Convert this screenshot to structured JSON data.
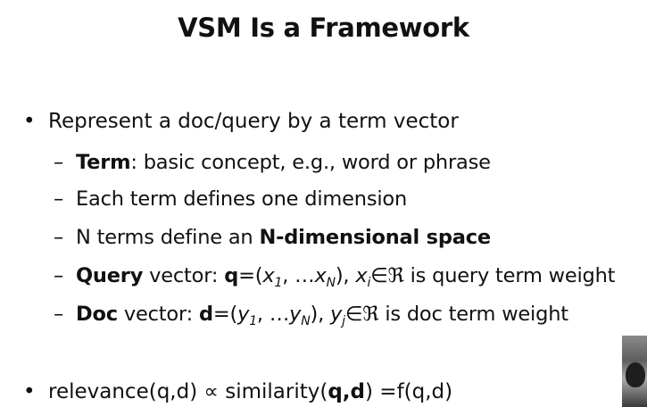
{
  "slide": {
    "title": "VSM Is a Framework",
    "bullet_symbol": "•",
    "dash_symbol": "–",
    "main_bullet": "Represent a doc/query by a term vector",
    "items": {
      "term_bold": "Term",
      "term_rest": ": basic concept, e.g., word or phrase",
      "dimension": "Each term defines one dimension",
      "nterms_plain": "N terms define an ",
      "nterms_bold": "N-dimensional space",
      "query_bold": "Query",
      "query_text1": " vector: ",
      "query_vec": "q",
      "query_text2": "=(",
      "query_x1": "x",
      "query_sub1": "1",
      "query_text3": ", …",
      "query_xn": "x",
      "query_subn": "N",
      "query_text4": "), ",
      "query_xi": "x",
      "query_subi": "i",
      "query_text5": "∈ℜ is query term weight",
      "doc_bold": "Doc",
      "doc_text1": " vector: ",
      "doc_vec": "d",
      "doc_text2": "=(",
      "doc_y1": "y",
      "doc_sub1": "1",
      "doc_text3": ", …",
      "doc_yn": "y",
      "doc_subn": "N",
      "doc_text4": "), ",
      "doc_yj": "y",
      "doc_subj": "j",
      "doc_text5": "∈ℜ is doc term weight"
    },
    "relevance": {
      "text1": "relevance(q,d) ∝ similarity(",
      "bold": "q,d",
      "text2": ") =f(q,d)"
    }
  }
}
